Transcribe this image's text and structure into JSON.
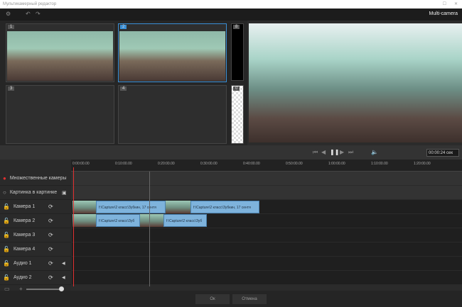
{
  "window": {
    "title": "Мультикамерный редактор",
    "mode": "Multi-camera"
  },
  "grid": {
    "cells": [
      "1",
      "2",
      "3",
      "4"
    ],
    "side": [
      "8",
      "0"
    ]
  },
  "player": {
    "time": "00:00:24",
    "unit": "сек"
  },
  "ruler": {
    "ticks": [
      "0:00:00.00",
      "0:10:00.00",
      "0:20:00.00",
      "0:30:00.00",
      "0:40:00.00",
      "0:50:00.00",
      "1:00:00.00",
      "1:10:00.00",
      "1:20:00.00"
    ]
  },
  "tracks": [
    {
      "label": "Множественные камеры",
      "icon": "record-icon"
    },
    {
      "label": "Картинка в картинке",
      "icon": "radio-icon"
    },
    {
      "label": "Камера 1",
      "icon": "lock-icon"
    },
    {
      "label": "Камера 2",
      "icon": "lock-icon"
    },
    {
      "label": "Камера 3",
      "icon": "lock-icon"
    },
    {
      "label": "Камера 4",
      "icon": "lock-icon"
    },
    {
      "label": "Аудио 1",
      "icon": "lock-icon"
    },
    {
      "label": "Аудио 2",
      "icon": "lock-icon"
    }
  ],
  "clips": {
    "cam1": [
      "f:\\Capture\\2 класс\\Зубкин, 17 сентя",
      "f:\\Capture\\2 класс\\Зубкин, 17 сентя"
    ],
    "cam2": [
      "f:\\Capture\\2 класс\\Зуб",
      "f:\\Capture\\2 класс\\Зуб"
    ]
  },
  "footer": {
    "ok": "Ок",
    "cancel": "Отмена"
  },
  "colors": {
    "accent": "#3a8fd6",
    "clip": "#7eb3dc",
    "playhead": "#e03030"
  }
}
